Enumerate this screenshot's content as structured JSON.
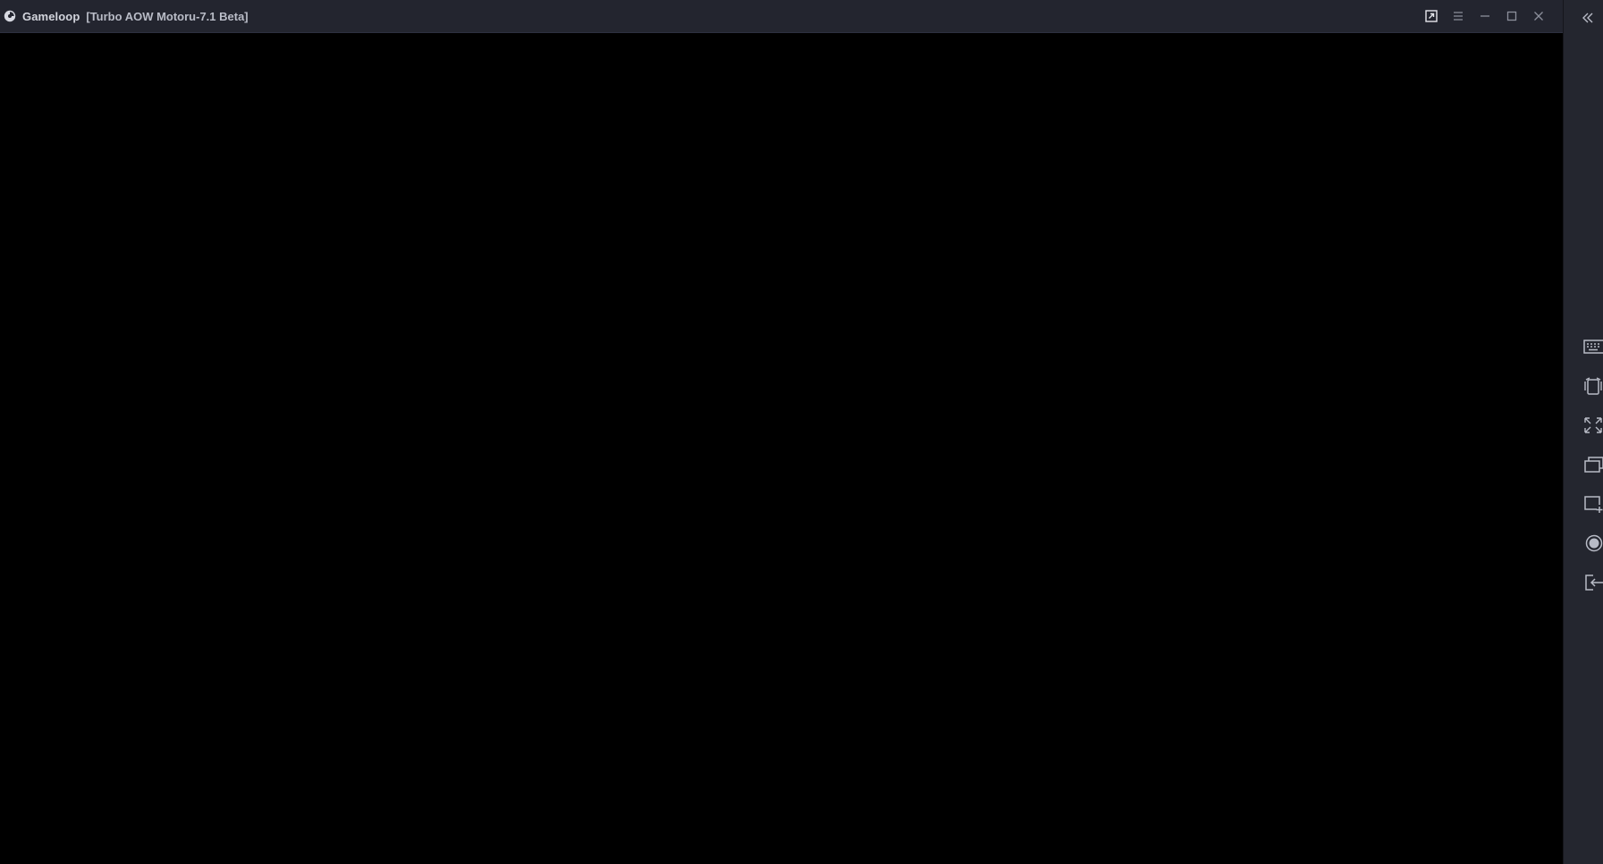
{
  "window": {
    "app_name": "Gameloop",
    "instance_title": "[Turbo AOW Motoru-7.1 Beta]"
  },
  "titlebar_buttons": [
    {
      "name": "popout-icon"
    },
    {
      "name": "menu-icon"
    },
    {
      "name": "minimize-icon"
    },
    {
      "name": "maximize-icon"
    },
    {
      "name": "close-icon"
    }
  ],
  "sidebar_tools": [
    {
      "name": "keyboard-icon"
    },
    {
      "name": "shake-icon"
    },
    {
      "name": "fullscreen-icon"
    },
    {
      "name": "multi-window-icon"
    },
    {
      "name": "screenshot-icon"
    },
    {
      "name": "record-icon"
    },
    {
      "name": "exit-icon"
    }
  ],
  "colors": {
    "titlebar_bg": "#23252f",
    "sidebar_bg": "#24262f",
    "icon": "#b8bbc6",
    "viewport_bg": "#000000"
  }
}
